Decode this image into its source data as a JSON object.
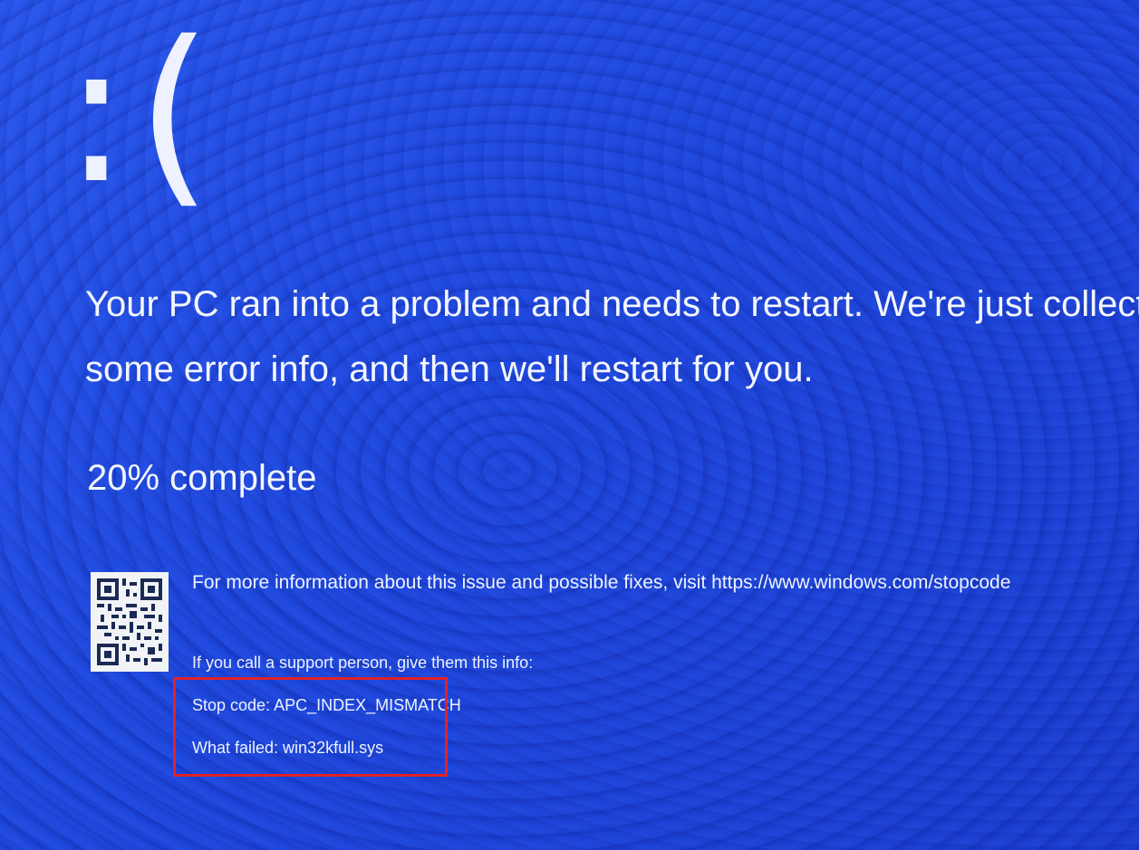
{
  "screen": {
    "background_color": "#1f48e0",
    "text_color": "#f4f6ff",
    "highlight_color": "#e0222a"
  },
  "frown": ":(",
  "message": {
    "line1": "Your PC ran into a problem and needs to restart. We're just collecting",
    "line2": "some error info, and then we'll restart for you."
  },
  "progress": {
    "percent": 20,
    "text": "20% complete"
  },
  "qr_code": {
    "icon": "qr-code-icon"
  },
  "info": {
    "more_info": "For more information about this issue and possible fixes, visit https://www.windows.com/stopcode",
    "support_prompt": "If you call a support person, give them this info:",
    "stop_code": "Stop code: APC_INDEX_MISMATCH",
    "what_failed": "What failed: win32kfull.sys"
  }
}
